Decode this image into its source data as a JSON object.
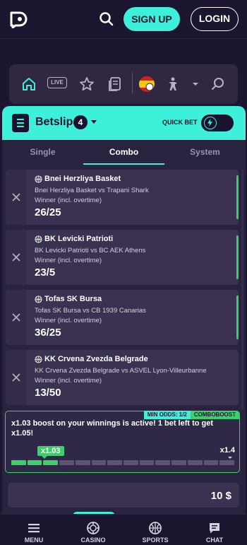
{
  "header": {
    "logo_icon": "brand-logo-icon",
    "search_icon": "search-icon",
    "signup_label": "SIGN UP",
    "login_label": "LOGIN"
  },
  "categories": {
    "live_label": "LIVE",
    "items": [
      "home-icon",
      "live-icon",
      "star-icon",
      "betslip-history-icon",
      "spain-flag-icon",
      "esports-shooter-icon",
      "chevron-down-icon",
      "search-icon"
    ]
  },
  "betslip": {
    "title": "Betslip",
    "count": "4",
    "quick_bet_label": "QUICK BET",
    "quick_bet_on": false,
    "tabs": [
      {
        "label": "Single",
        "active": false
      },
      {
        "label": "Combo",
        "active": true
      },
      {
        "label": "System",
        "active": false
      }
    ],
    "bets": [
      {
        "team": "Bnei Herzliya Basket",
        "match": "Bnei Herzliya Basket vs Trapani Shark",
        "market": "Winner (incl. overtime)",
        "odds": "26/25"
      },
      {
        "team": "BK Levicki Patrioti",
        "match": "BK Levicki Patrioti vs BC AEK Athens",
        "market": "Winner (incl. overtime)",
        "odds": "23/5"
      },
      {
        "team": "Tofas SK Bursa",
        "match": "Tofas SK Bursa vs CB 1939 Canarias",
        "market": "Winner (incl. overtime)",
        "odds": "36/25"
      },
      {
        "team": "KK Crvena Zvezda Belgrade",
        "match": "KK Crvena Zvezda Belgrade vs ASVEL Lyon-Villeurbanne",
        "market": "Winner (incl. overtime)",
        "odds": "13/50"
      }
    ],
    "boost": {
      "min_odds_label": "MIN ODDS: 1/2",
      "badge_label": "COMBOBOOST",
      "message": "x1.03 boost on your winnings is active! 1 bet left to get x1.05!",
      "current": "x1.03",
      "target": "x1.4",
      "segments_total": 14,
      "segments_filled": 3
    },
    "stake": "10 $"
  },
  "bottom_nav": [
    {
      "label": "MENU",
      "icon": "menu-icon"
    },
    {
      "label": "CASINO",
      "icon": "casino-chip-icon"
    },
    {
      "label": "SPORTS",
      "icon": "basketball-icon"
    },
    {
      "label": "CHAT",
      "icon": "chat-icon"
    }
  ],
  "colors": {
    "accent": "#3ef0d9",
    "boost_green": "#3bd06a",
    "background": "#1d1630",
    "panel": "#2a2340",
    "card": "#3a3250"
  }
}
